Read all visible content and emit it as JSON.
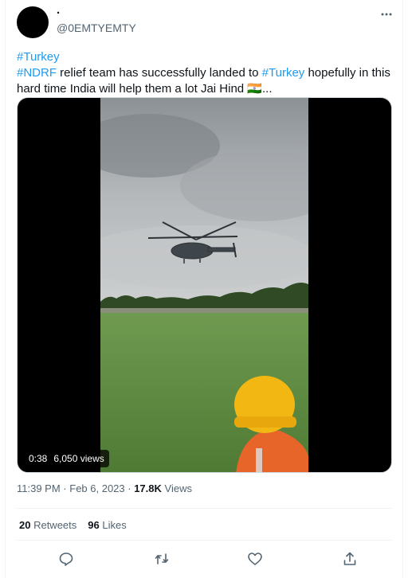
{
  "author": {
    "display_name": ".",
    "handle": "@0EMTYEMTY"
  },
  "tweet": {
    "hashtag_line": "#Turkey",
    "line2_hashtag": "#NDRF",
    "line2_text": " relief team has successfully landed to ",
    "line2_hashtag2": "#Turkey",
    "line2_text2": " hopefully in this",
    "line3_text": "hard time India will help them a lot Jai Hind ",
    "line3_flag": "🇮🇳",
    "line3_ellipsis": "...",
    "link_color": "#1d9bf0"
  },
  "video": {
    "duration": "0:38",
    "views": "6,050 views"
  },
  "meta": {
    "time": "11:39 PM",
    "separator": " · ",
    "date": "Feb 6, 2023",
    "views_count": "17.8K",
    "views_label": " Views"
  },
  "stats": {
    "retweets_count": "20",
    "retweets_label": " Retweets",
    "likes_count": "96",
    "likes_label": " Likes"
  },
  "icons": {
    "more": "more-horizontal-icon",
    "reply": "reply-icon",
    "retweet": "retweet-icon",
    "like": "like-icon",
    "share": "share-icon"
  }
}
